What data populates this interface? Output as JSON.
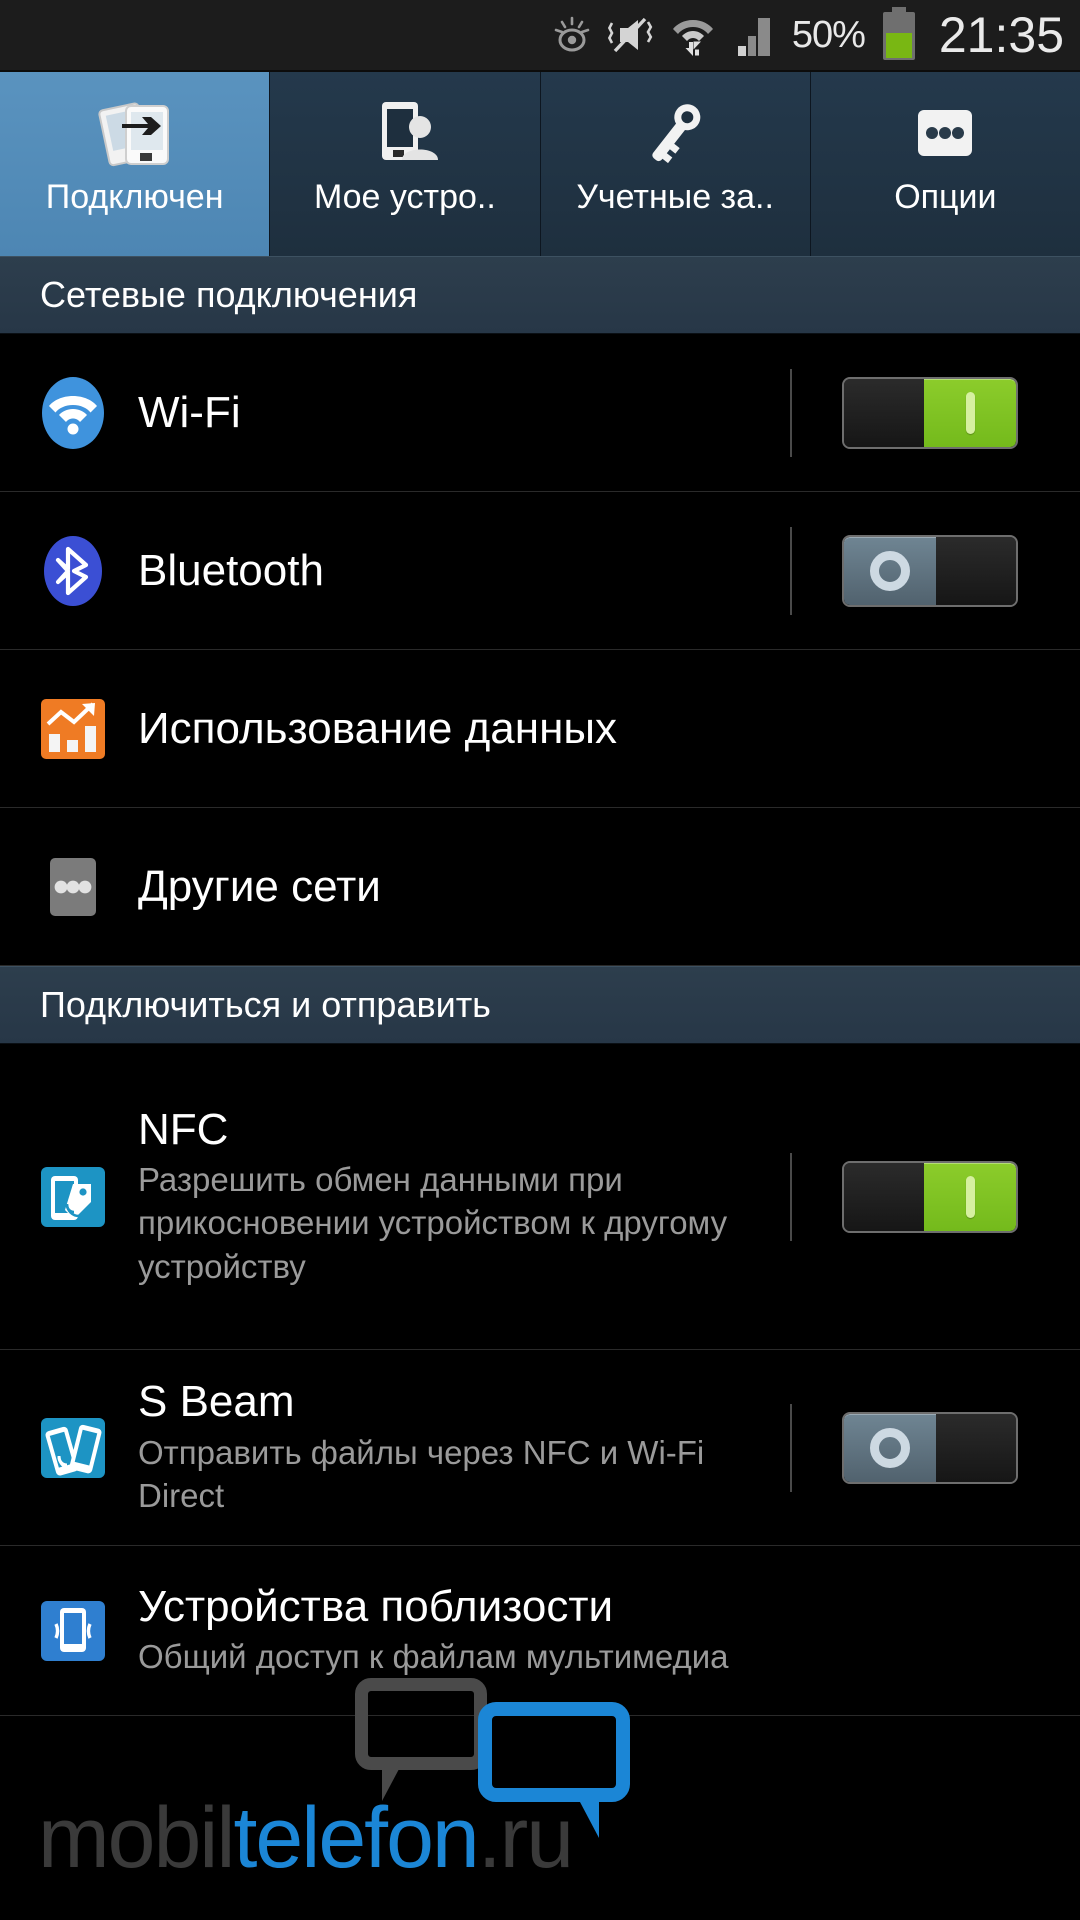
{
  "statusbar": {
    "icons": [
      "smart-stay-eye-icon",
      "sound-muted-vibrate-icon",
      "wifi-data-transfer-icon",
      "cellular-signal-icon"
    ],
    "battery_percent": "50%",
    "clock": "21:35"
  },
  "tabs": [
    {
      "label": "Подключен",
      "icon": "connections-icon",
      "active": true,
      "name": "tab-connections"
    },
    {
      "label": "Мое устро..",
      "icon": "my-device-icon",
      "active": false,
      "name": "tab-my-device"
    },
    {
      "label": "Учетные за..",
      "icon": "accounts-key-icon",
      "active": false,
      "name": "tab-accounts"
    },
    {
      "label": "Опции",
      "icon": "more-options-icon",
      "active": false,
      "name": "tab-options"
    }
  ],
  "sections": [
    {
      "header": "Сетевые подключения",
      "rows": [
        {
          "title": "Wi-Fi",
          "desc": "",
          "icon": "wifi-icon",
          "toggle": "on"
        },
        {
          "title": "Bluetooth",
          "desc": "",
          "icon": "bluetooth-icon",
          "toggle": "off"
        },
        {
          "title": "Использование данных",
          "desc": "",
          "icon": "data-usage-icon",
          "toggle": "none"
        },
        {
          "title": "Другие сети",
          "desc": "",
          "icon": "other-networks-icon",
          "toggle": "none"
        }
      ]
    },
    {
      "header": "Подключиться и отправить",
      "rows": [
        {
          "title": "NFC",
          "desc": "Разрешить обмен данными при прикосновении устройством к другому устройству",
          "icon": "nfc-icon",
          "toggle": "on"
        },
        {
          "title": "S Beam",
          "desc": "Отправить файлы через NFC и Wi-Fi Direct",
          "icon": "s-beam-icon",
          "toggle": "off"
        },
        {
          "title": "Устройства поблизости",
          "desc": "Общий доступ к файлам мультимедиа",
          "icon": "nearby-devices-icon",
          "toggle": "none"
        }
      ]
    }
  ],
  "watermark": {
    "part1": "mobil",
    "part2": "telefon",
    "part3": ".ru"
  },
  "colors": {
    "accent_blue": "#5a93bf",
    "tab_bg": "#24394c",
    "section_bg": "#2d3e4d",
    "toggle_on": "#7cc122",
    "toggle_off": "#6f8593",
    "wifi_icon": "#3f93dd",
    "bluetooth_icon": "#3b4fd4",
    "data_icon": "#ef7b24",
    "nfc_icon": "#1d94c4",
    "background": "#000000",
    "text_primary": "#ffffff",
    "text_secondary": "#9a9a9a"
  }
}
